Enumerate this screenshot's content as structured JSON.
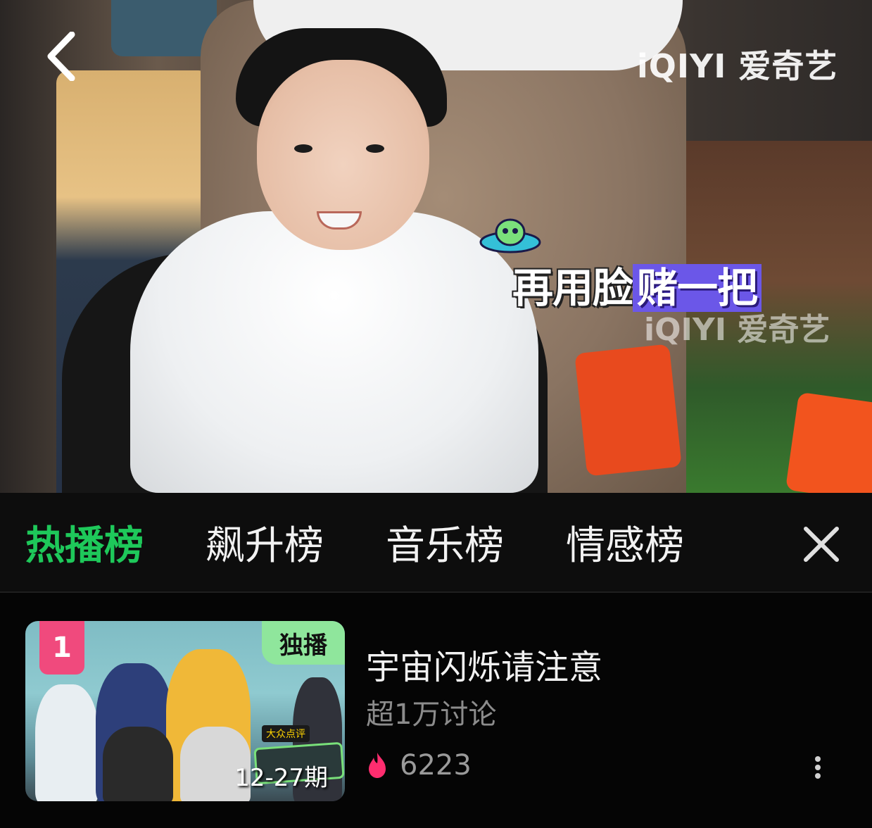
{
  "player": {
    "watermark": "iQIYI 爱奇艺",
    "subtitle_part1": "再用脸",
    "subtitle_part2": "赌一把",
    "back_icon": "chevron-left-icon"
  },
  "ranking_tabs": {
    "tabs": [
      {
        "label": "热播榜",
        "active": true
      },
      {
        "label": "飙升榜",
        "active": false
      },
      {
        "label": "音乐榜",
        "active": false
      },
      {
        "label": "情感榜",
        "active": false
      }
    ],
    "active_color": "#1ec85a",
    "close_icon": "close-icon"
  },
  "list": {
    "items": [
      {
        "rank": "1",
        "badge": "独播",
        "episode": "12-27期",
        "sponsor": "大众点评",
        "title": "宇宙闪烁请注意",
        "discussion": "超1万讨论",
        "heat": "6223",
        "rank_color": "#f04a7d",
        "badge_color": "#8fe69c",
        "heat_icon": "flame-icon",
        "more_icon": "more-vertical-icon"
      }
    ]
  }
}
